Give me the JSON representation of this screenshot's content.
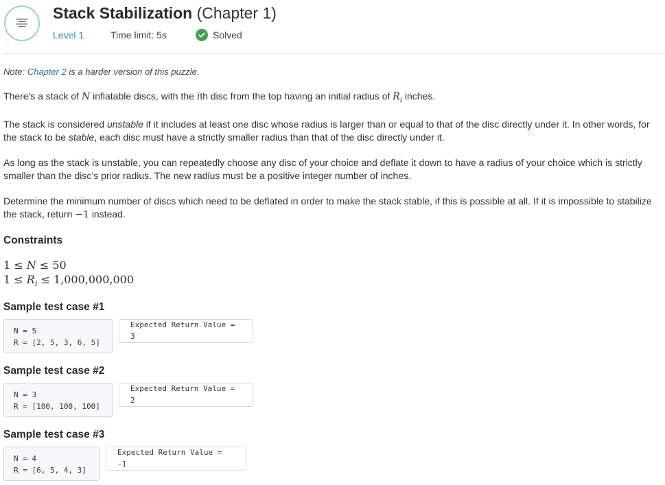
{
  "header": {
    "title": "Stack Stabilization",
    "title_suffix": "(Chapter 1)",
    "level": "Level 1",
    "time_limit": "Time limit: 5s",
    "status": "Solved",
    "status_color": "#3fa34d",
    "accent": "#2f8fb8"
  },
  "note": {
    "prefix": "Note:",
    "link": "Chapter 2",
    "rest": "is a harder version of this puzzle."
  },
  "p1": {
    "a": "There's a stack of",
    "N": "N",
    "b": "inflatable discs, with the",
    "i": "i",
    "c": "th disc from the top having an initial radius of",
    "R": "R",
    "Rsub": "i",
    "d": "inches."
  },
  "p2": {
    "a": "The stack is considered",
    "unstable": "unstable",
    "b": "if it includes at least one disc whose radius is larger than or equal to that of the disc directly under it. In other words, for the stack to be",
    "stable": "stable",
    "c": ", each disc must have a strictly smaller radius than that of the disc directly under it."
  },
  "p3": "As long as the stack is unstable, you can repeatedly choose any disc of your choice and deflate it down to have a radius of your choice which is strictly smaller than the disc’s prior radius. The new radius must be a positive integer number of inches.",
  "p4": {
    "a": "Determine the minimum number of discs which need to be deflated in order to make the stack stable, if this is possible at all. If it is impossible to stabilize the stack, return",
    "neg": "−1",
    "b": "instead."
  },
  "constraints": {
    "heading": "Constraints",
    "c1": {
      "lo": "1",
      "le1": "≤",
      "var": "N",
      "le2": "≤",
      "hi": "50"
    },
    "c2": {
      "lo": "1",
      "le1": "≤",
      "var": "R",
      "sub": "i",
      "le2": "≤",
      "hi": "1,000,000,000"
    }
  },
  "samples": [
    {
      "heading": "Sample test case #1",
      "input_n": "N = 5",
      "input_r": "R = [2, 5, 3, 6, 5]",
      "output": "Expected Return Value = 3"
    },
    {
      "heading": "Sample test case #2",
      "input_n": "N = 3",
      "input_r": "R = [100, 100, 100]",
      "output": "Expected Return Value = 2"
    },
    {
      "heading": "Sample test case #3",
      "input_n": "N = 4",
      "input_r": "R = [6, 5, 4, 3]",
      "output": "Expected Return Value = -1"
    }
  ],
  "icons": {
    "menu": "menu-lines-icon",
    "check": "check-circle-icon"
  }
}
